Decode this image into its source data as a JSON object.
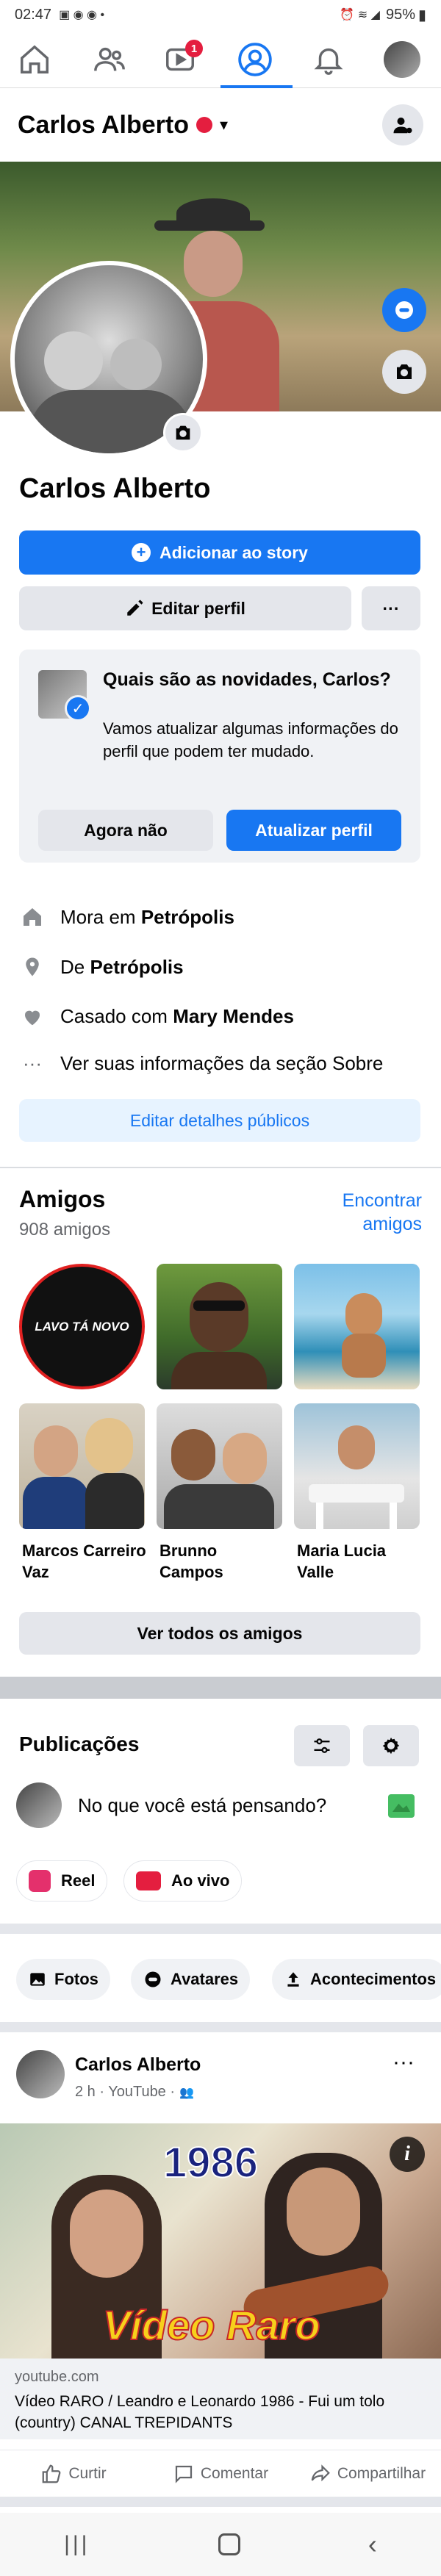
{
  "status_bar": {
    "time": "02:47",
    "battery": "95%"
  },
  "nav": {
    "notification_badge": "1"
  },
  "header": {
    "name": "Carlos Alberto"
  },
  "profile": {
    "name": "Carlos Alberto",
    "add_story_label": "Adicionar ao story",
    "edit_profile_label": "Editar perfil",
    "more_label": "···"
  },
  "update_card": {
    "title": "Quais são as novidades, Carlos?",
    "body": "Vamos atualizar algumas informações do perfil que podem ter mudado.",
    "not_now_label": "Agora não",
    "update_label": "Atualizar perfil"
  },
  "about": {
    "lives_prefix": "Mora em ",
    "lives_city": "Petrópolis",
    "from_prefix": "De ",
    "from_city": "Petrópolis",
    "married_prefix": "Casado com ",
    "married_to": "Mary Mendes",
    "see_about": "Ver suas informações da seção Sobre",
    "edit_details_label": "Editar detalhes públicos"
  },
  "friends": {
    "title": "Amigos",
    "count": "908 amigos",
    "find_label_line1": "Encontrar",
    "find_label_line2": "amigos",
    "logo_text": "LAVO TÁ NOVO",
    "items": [
      {
        "name": ""
      },
      {
        "name": ""
      },
      {
        "name": ""
      },
      {
        "name": "Marcos Carreiro Vaz"
      },
      {
        "name": "Brunno Campos"
      },
      {
        "name": "Maria Lucia Valle"
      }
    ],
    "see_all_label": "Ver todos os amigos"
  },
  "posts": {
    "title": "Publicações",
    "composer_placeholder": "No que você está pensando?",
    "reel_label": "Reel",
    "live_label": "Ao vivo",
    "chips": [
      "Fotos",
      "Avatares",
      "Acontecimentos"
    ]
  },
  "post": {
    "author": "Carlos Alberto",
    "meta": "2 h · YouTube ·",
    "thumb_year": "1986",
    "thumb_caption": "Vídeo Raro",
    "link_domain": "youtube.com",
    "link_title": "Vídeo RARO / Leandro e Leonardo 1986 - Fui um tolo (country) CANAL TREPIDANTS",
    "like_label": "Curtir",
    "comment_label": "Comentar",
    "share_label": "Compartilhar"
  },
  "colors": {
    "accent": "#1877f2",
    "divider": "#c9ccd1",
    "badge": "#e41e3f"
  }
}
